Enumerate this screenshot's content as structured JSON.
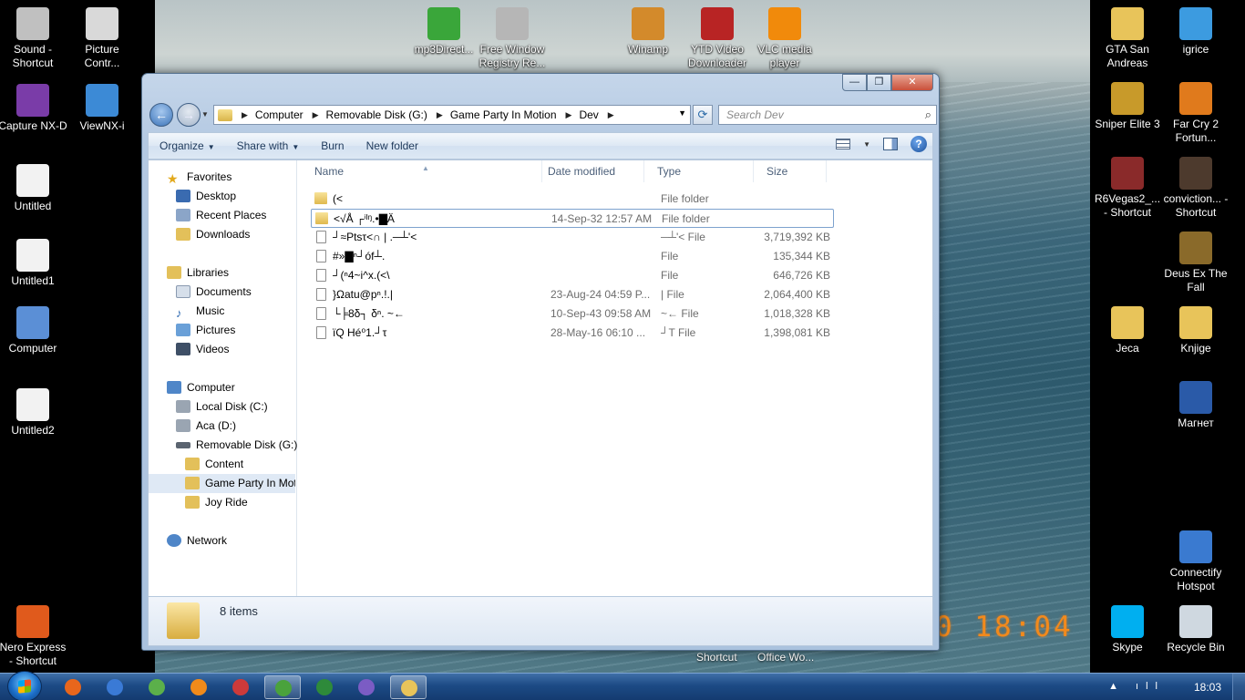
{
  "desktop": {
    "left_icons": [
      {
        "label": "Sound - Shortcut",
        "icon": "speaker-icon",
        "color": "#c0c0c0"
      },
      {
        "label": "Picture Contr...",
        "icon": "picture-control-icon",
        "color": "#d9d9d9"
      },
      {
        "label": "Capture NX-D",
        "icon": "capture-nxd-icon",
        "color": "#7a3ca8"
      },
      {
        "label": "ViewNX-i",
        "icon": "viewnx-icon",
        "color": "#3c8ad6"
      },
      {
        "label": "Untitled",
        "icon": "document-icon",
        "color": "#f2f2f2"
      },
      {
        "label": "Untitled1",
        "icon": "document-icon",
        "color": "#f2f2f2"
      },
      {
        "label": "Computer",
        "icon": "computer-icon",
        "color": "#5b8fd6"
      },
      {
        "label": "Untitled2",
        "icon": "document-icon",
        "color": "#f2f2f2"
      },
      {
        "label": "Nero Express - Shortcut",
        "icon": "nero-icon",
        "color": "#e05a1c"
      }
    ],
    "top_icons": [
      {
        "label": "mp3Direct...",
        "icon": "mp3cut-icon",
        "color": "#3aa63a"
      },
      {
        "label": "Free Window Registry Re...",
        "icon": "registry-tools-icon",
        "color": "#b6b6b6"
      },
      {
        "label": "Winamp",
        "icon": "winamp-icon",
        "color": "#d38a2b"
      },
      {
        "label": "YTD Video Downloader",
        "icon": "ytd-icon",
        "color": "#b82424"
      },
      {
        "label": "VLC media player",
        "icon": "vlc-icon",
        "color": "#f18a0b"
      }
    ],
    "right_icons": [
      {
        "label": "GTA San Andreas",
        "icon": "folder-icon",
        "color": "#e8c45a"
      },
      {
        "label": "igrice",
        "icon": "butterfly-icon",
        "color": "#3c9be0"
      },
      {
        "label": "Sniper Elite 3",
        "icon": "game-icon",
        "color": "#c89a2a"
      },
      {
        "label": "Far Cry 2 Fortun...",
        "icon": "farcry-icon",
        "color": "#e07a1c"
      },
      {
        "label": "R6Vegas2_... - Shortcut",
        "icon": "game-icon",
        "color": "#8a2a2a"
      },
      {
        "label": "conviction... - Shortcut",
        "icon": "game-icon",
        "color": "#4d3a2d"
      },
      {
        "label": "Deus Ex The Fall",
        "icon": "game-icon",
        "color": "#8a6a2a"
      },
      {
        "label": "Jeca",
        "icon": "folder-icon",
        "color": "#e8c45a"
      },
      {
        "label": "Knjige",
        "icon": "folder-icon",
        "color": "#e8c45a"
      },
      {
        "label": "Магнет",
        "icon": "word-document-icon",
        "color": "#2a5aa8"
      },
      {
        "label": "Connectify Hotspot",
        "icon": "connectify-icon",
        "color": "#3a7ad0"
      },
      {
        "label": "Skype",
        "icon": "skype-icon",
        "color": "#00aff0"
      },
      {
        "label": "Recycle Bin",
        "icon": "recycle-bin-icon",
        "color": "#cfd8e0"
      }
    ],
    "behind_labels": [
      "Shortcut",
      "Office Wo..."
    ],
    "date_stamp": "0 18:04"
  },
  "window": {
    "title_buttons": {
      "minimize": "—",
      "maximize": "❐",
      "close": "✕"
    },
    "breadcrumb": [
      "Computer",
      "Removable Disk (G:)",
      "Game Party In Motion",
      "Dev"
    ],
    "search_placeholder": "Search Dev",
    "toolbar": {
      "organize": "Organize",
      "share_with": "Share with",
      "burn": "Burn",
      "new_folder": "New folder"
    },
    "nav": {
      "favorites": "Favorites",
      "favorites_items": [
        "Desktop",
        "Recent Places",
        "Downloads"
      ],
      "libraries": "Libraries",
      "libraries_items": [
        "Documents",
        "Music",
        "Pictures",
        "Videos"
      ],
      "computer": "Computer",
      "computer_items": [
        "Local Disk (C:)",
        "Aca (D:)",
        "Removable Disk (G:)"
      ],
      "removable_children": [
        "Content",
        "Game Party In Mot",
        "Joy Ride"
      ],
      "network": "Network"
    },
    "columns": {
      "name": "Name",
      "date": "Date modified",
      "type": "Type",
      "size": "Size"
    },
    "files": [
      {
        "name": "(<",
        "date": "",
        "type": "File folder",
        "size": "",
        "kind": "folder"
      },
      {
        "name": "<√Å ┌ⁱᴵᵑ.•▇Ä",
        "date": "14-Sep-32 12:57 AM",
        "type": "File folder",
        "size": "",
        "kind": "folder"
      },
      {
        "name": "┘≈Ptsτ<∩ | .─┴'<",
        "date": "",
        "type": "─┴'< File",
        "size": "3,719,392 KB",
        "kind": "file"
      },
      {
        "name": "#»▇ⁿ┘óf┴.",
        "date": "",
        "type": "File",
        "size": "135,344 KB",
        "kind": "file"
      },
      {
        "name": "┘(ⁿ4~i^x.(<\\",
        "date": "",
        "type": "File",
        "size": "646,726 KB",
        "kind": "file"
      },
      {
        "name": "}Ωatu@pⁿ.!.|",
        "date": "23-Aug-24 04:59 P...",
        "type": "| File",
        "size": "2,064,400 KB",
        "kind": "file"
      },
      {
        "name": "└╞8δ┐ δⁿ.   ~←",
        "date": "10-Sep-43 09:58 AM",
        "type": "~← File",
        "size": "1,018,328 KB",
        "kind": "file"
      },
      {
        "name": "ïQ  Hé⁰1.┘τ",
        "date": "28-May-16 06:10 ...",
        "type": "┘T File",
        "size": "1,398,081 KB",
        "kind": "file"
      }
    ],
    "status_count": "8 items"
  },
  "taskbar": {
    "clock": "18:03",
    "tray_glyphs": "▲ ıll",
    "tasks": [
      {
        "icon": "firefox-icon",
        "color": "#e8661c",
        "active": false
      },
      {
        "icon": "thunderbolt-icon",
        "color": "#3a7ad6",
        "active": false
      },
      {
        "icon": "chrome-icon",
        "color": "#5bb04a",
        "active": false
      },
      {
        "icon": "avast-icon",
        "color": "#f08a1a",
        "active": false
      },
      {
        "icon": "tools-icon",
        "color": "#cc3a3a",
        "active": false
      },
      {
        "icon": "mp3cut-task-icon",
        "color": "#4aa23c",
        "active": true
      },
      {
        "icon": "green-app-icon",
        "color": "#2e8a3a",
        "active": false
      },
      {
        "icon": "viber-icon",
        "color": "#7b5cc4",
        "active": false
      },
      {
        "icon": "explorer-icon",
        "color": "#e8c45a",
        "active": true
      }
    ]
  }
}
